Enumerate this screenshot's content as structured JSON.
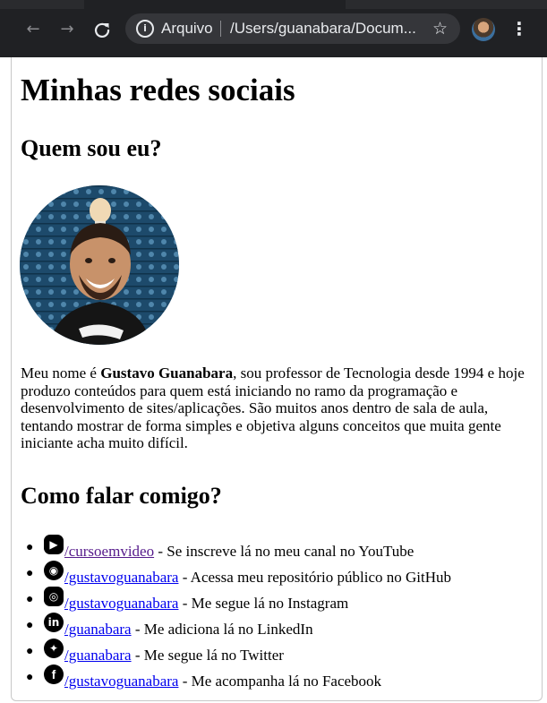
{
  "browser": {
    "nav_back_icon": "arrow-left-icon",
    "nav_forward_icon": "arrow-right-icon",
    "reload_icon": "reload-icon",
    "security_label": "Arquivo",
    "url": "/Users/guanabara/Docum...",
    "bookmark_icon": "star-icon",
    "menu_icon": "kebab-menu-icon"
  },
  "page": {
    "title": "Minhas redes sociais",
    "about_heading": "Quem sou eu?",
    "bio": {
      "prefix": "Meu nome é ",
      "name": "Gustavo Guanabara",
      "suffix": ", sou professor de Tecnologia desde 1994 e hoje produzo conteúdos para quem está iniciando no ramo da programação e desenvolvimento de sites/aplicações. São muitos anos dentro de sala de aula, tentando mostrar de forma simples e objetiva alguns conceitos que muita gente iniciante acha muito difícil."
    },
    "contact_heading": "Como falar comigo?",
    "contacts": [
      {
        "icon": "youtube-icon",
        "link": "/cursoemvideo",
        "text": " - Se inscreve lá no meu canal no YouTube"
      },
      {
        "icon": "github-icon",
        "link": "/gustavoguanabara",
        "text": " - Acessa meu repositório público no GitHub"
      },
      {
        "icon": "instagram-icon",
        "link": "/gustavoguanabara",
        "text": " - Me segue lá no Instagram"
      },
      {
        "icon": "linkedin-icon",
        "link": "/guanabara",
        "text": " - Me adiciona lá no LinkedIn"
      },
      {
        "icon": "twitter-icon",
        "link": "/guanabara",
        "text": " - Me segue lá no Twitter"
      },
      {
        "icon": "facebook-icon",
        "link": "/gustavoguanabara",
        "text": " - Me acompanha lá no Facebook"
      }
    ]
  },
  "colors": {
    "chrome_bg": "#202124",
    "omnibox_bg": "#35363a",
    "link_blue": "#0000ee",
    "link_visited": "#551a8b"
  }
}
